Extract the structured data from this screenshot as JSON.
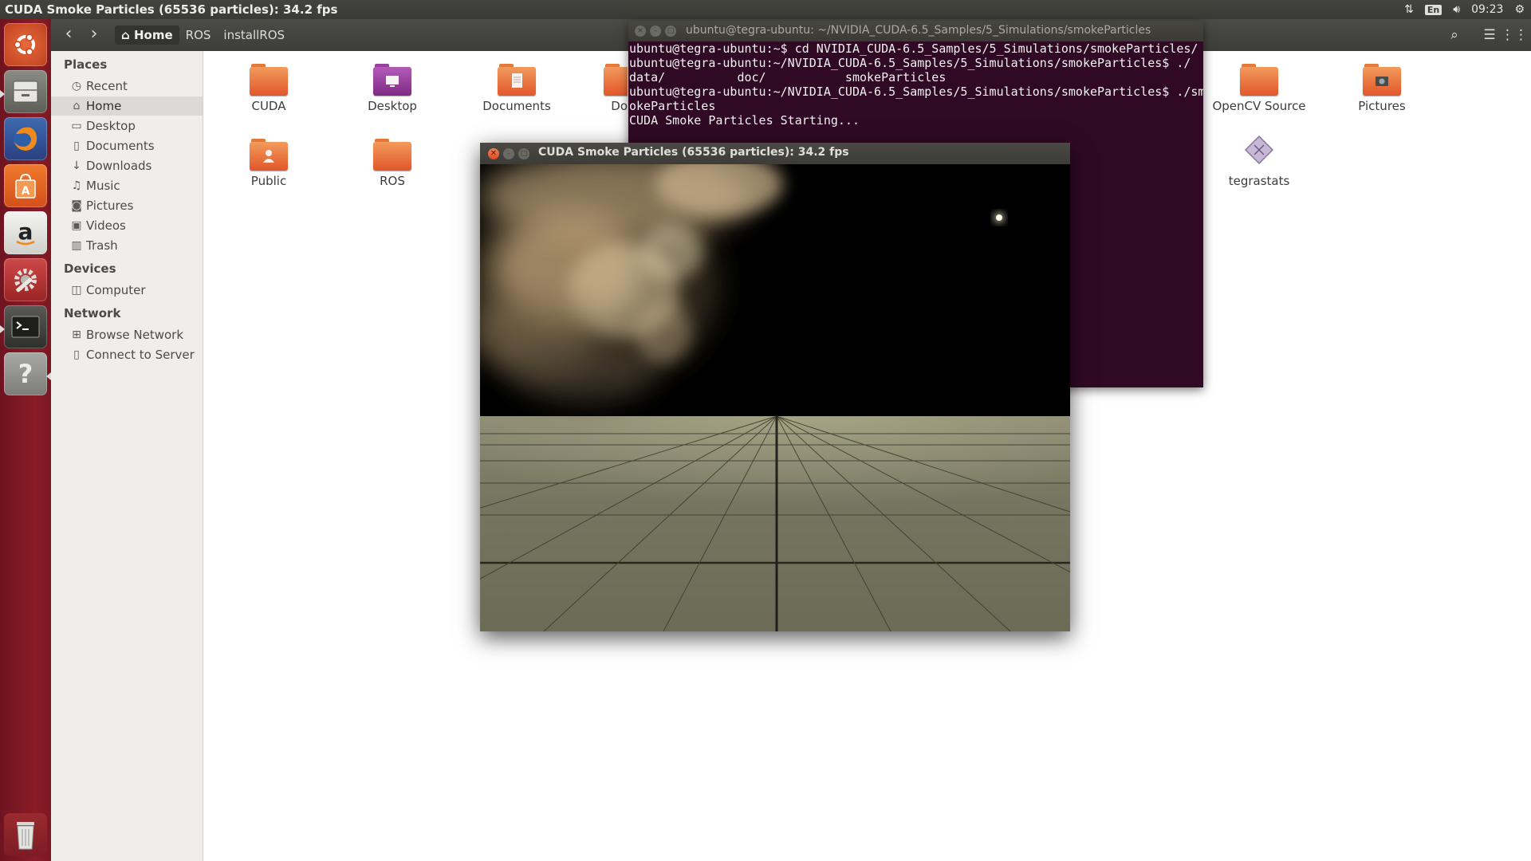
{
  "top_panel": {
    "title": "CUDA Smoke Particles (65536 particles): 34.2 fps",
    "keyboard": "En",
    "time": "09:23"
  },
  "launcher": {
    "items": [
      "dash-home",
      "files",
      "firefox",
      "software-center",
      "amazon",
      "system-settings",
      "terminal",
      "help",
      "trash"
    ]
  },
  "file_manager": {
    "breadcrumb": [
      "Home",
      "ROS",
      "installROS"
    ],
    "sidebar": {
      "places_heading": "Places",
      "places": [
        "Recent",
        "Home",
        "Desktop",
        "Documents",
        "Downloads",
        "Music",
        "Pictures",
        "Videos",
        "Trash"
      ],
      "devices_heading": "Devices",
      "devices": [
        "Computer"
      ],
      "network_heading": "Network",
      "network": [
        "Browse Network",
        "Connect to Server"
      ]
    },
    "icons": {
      "cuda": "CUDA",
      "desktop": "Desktop",
      "documents": "Documents",
      "downloads_partial": "Do",
      "opencv": "OpenCV Source",
      "pictures": "Pictures",
      "public": "Public",
      "ros": "ROS",
      "tegrastats": "tegrastats"
    }
  },
  "terminal": {
    "title": "ubuntu@tegra-ubuntu: ~/NVIDIA_CUDA-6.5_Samples/5_Simulations/smokeParticles",
    "lines": [
      "ubuntu@tegra-ubuntu:~$ cd NVIDIA_CUDA-6.5_Samples/5_Simulations/smokeParticles/",
      "ubuntu@tegra-ubuntu:~/NVIDIA_CUDA-6.5_Samples/5_Simulations/smokeParticles$ ./",
      "data/          doc/           smokeParticles",
      "ubuntu@tegra-ubuntu:~/NVIDIA_CUDA-6.5_Samples/5_Simulations/smokeParticles$ ./sm",
      "okeParticles",
      "CUDA Smoke Particles Starting..."
    ]
  },
  "smoke_window": {
    "title": "CUDA Smoke Particles (65536 particles): 34.2 fps"
  },
  "colors": {
    "launcher": "#7e1a24",
    "terminal_bg": "#300a24",
    "folder_orange": "#e2572a",
    "floor": "#75735c"
  }
}
